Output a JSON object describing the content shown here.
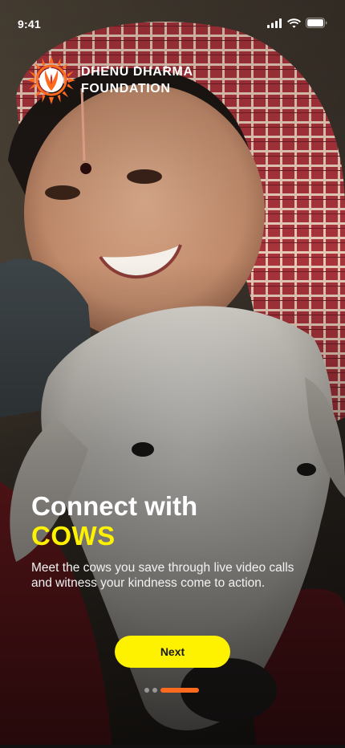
{
  "status_bar": {
    "time": "9:41",
    "icons": [
      "cellular-signal-icon",
      "wifi-icon",
      "battery-icon"
    ]
  },
  "brand": {
    "line1": "DHENU DHARMA",
    "line2": "FOUNDATION",
    "logo_icon": "sun-tilak-logo-icon"
  },
  "onboarding": {
    "headline": "Connect with",
    "headline_accent": "COWS",
    "description": "Meet the cows you save through live video calls and witness your kindness come to action.",
    "next_label": "Next",
    "pages_total": 3,
    "current_page": 3
  },
  "colors": {
    "accent_yellow": "#fff200",
    "accent_orange": "#ff6a1f",
    "text_white": "#ffffff"
  }
}
